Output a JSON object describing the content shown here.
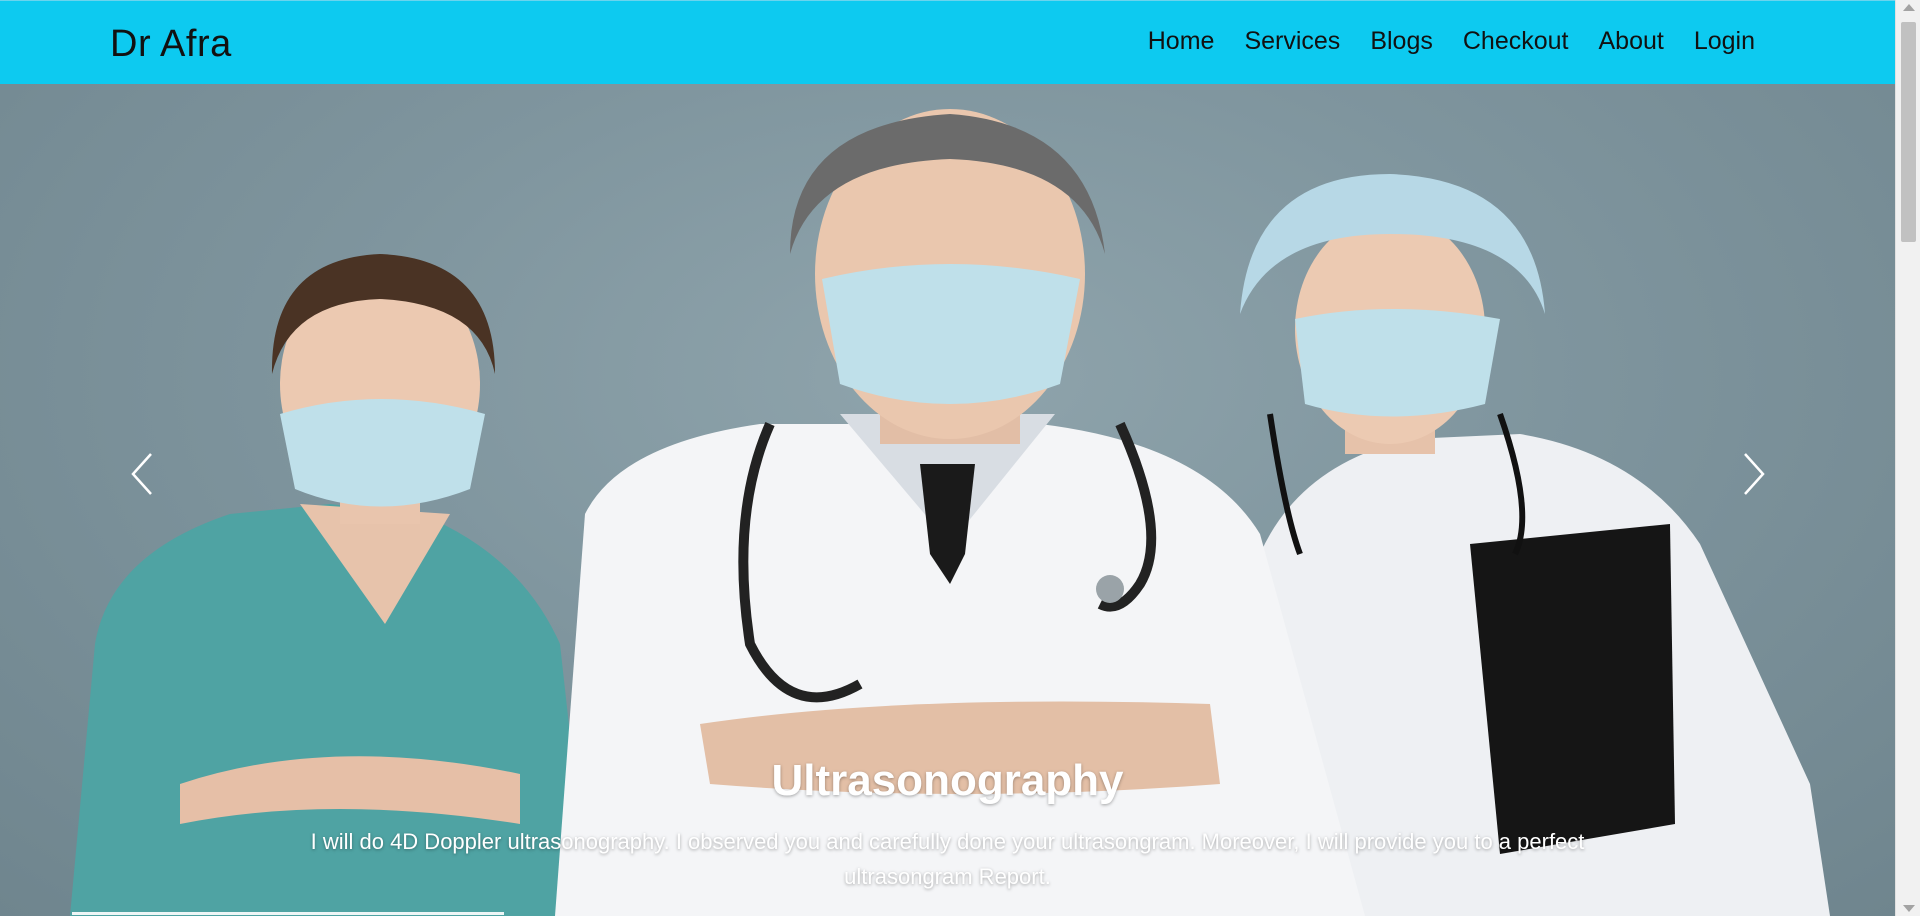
{
  "navbar": {
    "brand": "Dr Afra",
    "links": [
      "Home",
      "Services",
      "Blogs",
      "Checkout",
      "About",
      "Login"
    ]
  },
  "carousel": {
    "title": "Ultrasonography",
    "description": "I will do 4D Doppler ultrasonography. I observed you and carefully done your ultrasongram. Moreover, I will provide you to a perfect ultrasongram Report.",
    "prev_icon": "chevron-left-icon",
    "next_icon": "chevron-right-icon"
  },
  "colors": {
    "navbar_bg": "#0dcaf0",
    "hero_bg": "#7f959e"
  }
}
